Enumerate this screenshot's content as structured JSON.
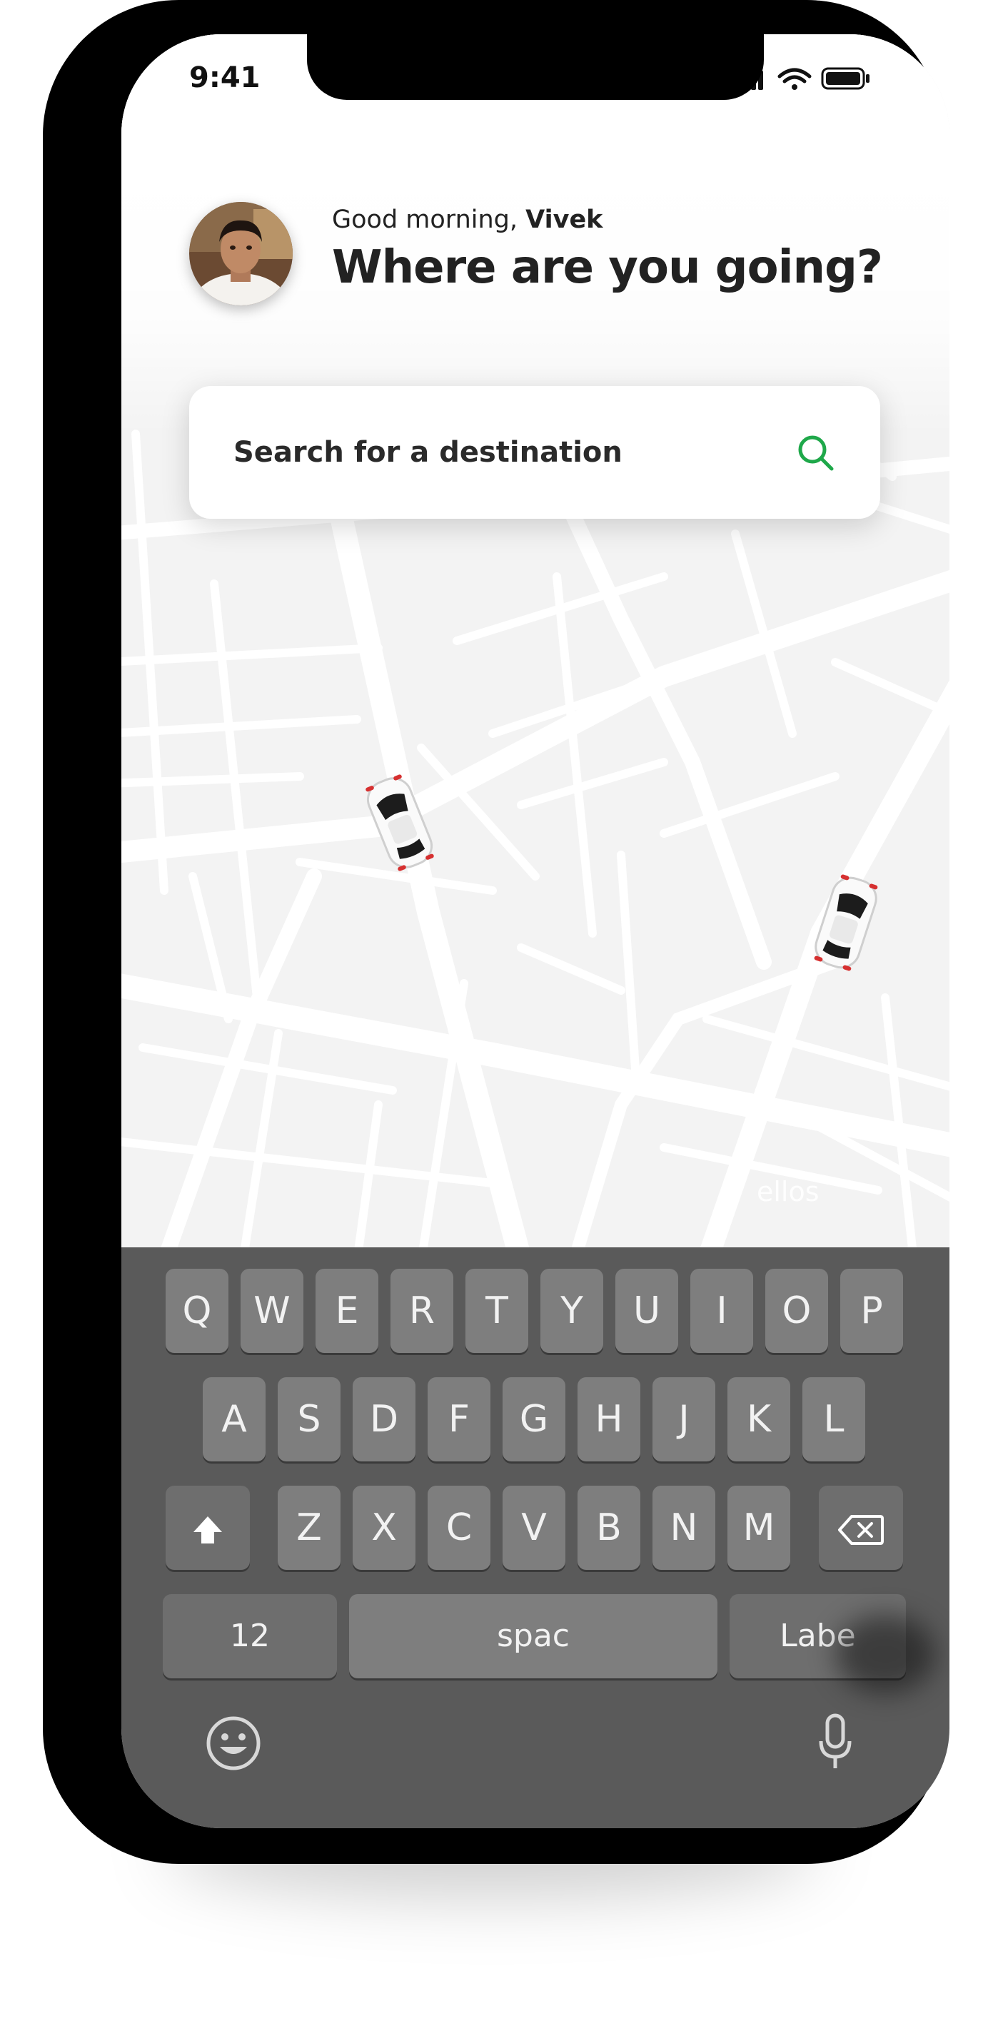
{
  "status_bar": {
    "time": "9:41"
  },
  "header": {
    "greeting_prefix": "Good morning,",
    "user_name": "Vivek",
    "headline": "Where are you going?"
  },
  "search": {
    "placeholder": "Search for a destination"
  },
  "map": {
    "watermark": "ellos"
  },
  "keyboard": {
    "row1": [
      "Q",
      "W",
      "E",
      "R",
      "T",
      "Y",
      "U",
      "I",
      "O",
      "P"
    ],
    "row2": [
      "A",
      "S",
      "D",
      "F",
      "G",
      "H",
      "J",
      "K",
      "L"
    ],
    "row3": [
      "Z",
      "X",
      "C",
      "V",
      "B",
      "N",
      "M"
    ],
    "numbers_label": "12",
    "space_label": "spac",
    "return_label": "Labe"
  },
  "colors": {
    "accent": "#1fa84a",
    "keyboard_bg": "#5a5a5a",
    "key_bg": "#7e7e7e"
  },
  "icons": [
    "wifi-icon",
    "signal-icon",
    "battery-icon",
    "search-icon",
    "shift-icon",
    "backspace-icon",
    "emoji-icon",
    "microphone-icon",
    "car-icon"
  ]
}
